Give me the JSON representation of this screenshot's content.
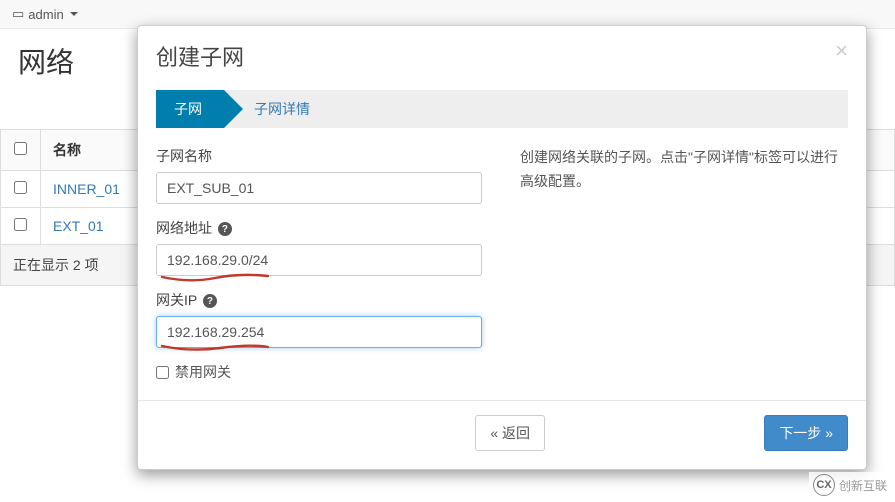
{
  "topbar": {
    "project": "admin"
  },
  "page": {
    "title": "网络"
  },
  "table": {
    "header_name": "名称",
    "rows": [
      {
        "name": "INNER_01"
      },
      {
        "name": "EXT_01"
      }
    ],
    "footer": "正在显示 2 项"
  },
  "modal": {
    "title": "创建子网",
    "close_label": "×",
    "tabs": {
      "subnet": "子网",
      "detail": "子网详情"
    },
    "fields": {
      "subnet_name_label": "子网名称",
      "subnet_name_value": "EXT_SUB_01",
      "cidr_label": "网络地址",
      "cidr_value": "192.168.29.0/24",
      "gateway_label": "网关IP",
      "gateway_value": "192.168.29.254",
      "disable_gw_label": "禁用网关"
    },
    "help_text": "创建网络关联的子网。点击\"子网详情\"标签可以进行高级配置。",
    "buttons": {
      "back": "« 返回",
      "next": "下一步 »"
    }
  },
  "watermark": "创新互联"
}
